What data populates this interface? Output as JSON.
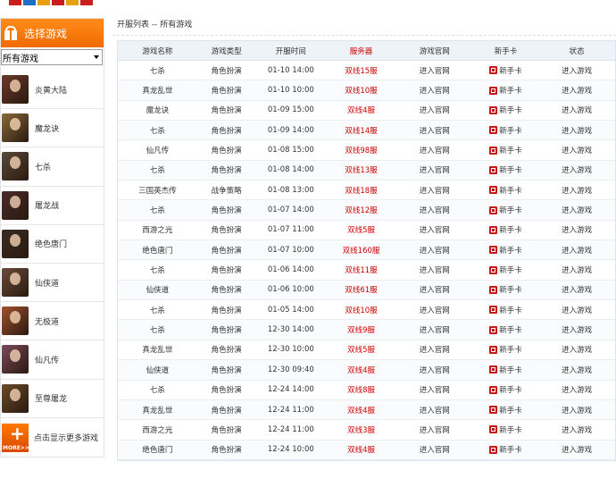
{
  "sidebar": {
    "title": "选择游戏",
    "select_value": "所有游戏",
    "games": [
      {
        "name": "炎黄大陆",
        "color": "#6b3a2a"
      },
      {
        "name": "魔龙诀",
        "color": "#8a6a3a"
      },
      {
        "name": "七杀",
        "color": "#5a4a3a"
      },
      {
        "name": "屠龙战",
        "color": "#4a2a2a"
      },
      {
        "name": "绝色唐门",
        "color": "#3a2a20"
      },
      {
        "name": "仙侠道",
        "color": "#6a4a3a"
      },
      {
        "name": "无极道",
        "color": "#a05030"
      },
      {
        "name": "仙凡传",
        "color": "#7a4a5a"
      },
      {
        "name": "至尊屠龙",
        "color": "#6a4a2a"
      }
    ],
    "more_label": "点击显示更多游戏",
    "more_icon_text": "MORE>>"
  },
  "main": {
    "breadcrumb": "开服列表 -- 所有游戏",
    "headers": [
      "游戏名称",
      "游戏类型",
      "开服时间",
      "服务器",
      "游戏官网",
      "新手卡",
      "状态"
    ],
    "rows": [
      {
        "name": "七杀",
        "type": "角色扮演",
        "time": "01-10 14:00",
        "server": "双线15服",
        "site": "进入官网",
        "card": "新手卡",
        "status": "进入游戏"
      },
      {
        "name": "真龙乱世",
        "type": "角色扮演",
        "time": "01-10 10:00",
        "server": "双线10服",
        "site": "进入官网",
        "card": "新手卡",
        "status": "进入游戏"
      },
      {
        "name": "魔龙诀",
        "type": "角色扮演",
        "time": "01-09 15:00",
        "server": "双线4服",
        "site": "进入官网",
        "card": "新手卡",
        "status": "进入游戏"
      },
      {
        "name": "七杀",
        "type": "角色扮演",
        "time": "01-09 14:00",
        "server": "双线14服",
        "site": "进入官网",
        "card": "新手卡",
        "status": "进入游戏"
      },
      {
        "name": "仙凡传",
        "type": "角色扮演",
        "time": "01-08 15:00",
        "server": "双线98服",
        "site": "进入官网",
        "card": "新手卡",
        "status": "进入游戏"
      },
      {
        "name": "七杀",
        "type": "角色扮演",
        "time": "01-08 14:00",
        "server": "双线13服",
        "site": "进入官网",
        "card": "新手卡",
        "status": "进入游戏"
      },
      {
        "name": "三国英杰传",
        "type": "战争策略",
        "time": "01-08 13:00",
        "server": "双线18服",
        "site": "进入官网",
        "card": "新手卡",
        "status": "进入游戏"
      },
      {
        "name": "七杀",
        "type": "角色扮演",
        "time": "01-07 14:00",
        "server": "双线12服",
        "site": "进入官网",
        "card": "新手卡",
        "status": "进入游戏"
      },
      {
        "name": "西游之光",
        "type": "角色扮演",
        "time": "01-07 11:00",
        "server": "双线5服",
        "site": "进入官网",
        "card": "新手卡",
        "status": "进入游戏"
      },
      {
        "name": "绝色唐门",
        "type": "角色扮演",
        "time": "01-07 10:00",
        "server": "双线160服",
        "site": "进入官网",
        "card": "新手卡",
        "status": "进入游戏"
      },
      {
        "name": "七杀",
        "type": "角色扮演",
        "time": "01-06 14:00",
        "server": "双线11服",
        "site": "进入官网",
        "card": "新手卡",
        "status": "进入游戏"
      },
      {
        "name": "仙侠道",
        "type": "角色扮演",
        "time": "01-06 10:00",
        "server": "双线61服",
        "site": "进入官网",
        "card": "新手卡",
        "status": "进入游戏"
      },
      {
        "name": "七杀",
        "type": "角色扮演",
        "time": "01-05 14:00",
        "server": "双线10服",
        "site": "进入官网",
        "card": "新手卡",
        "status": "进入游戏"
      },
      {
        "name": "七杀",
        "type": "角色扮演",
        "time": "12-30 14:00",
        "server": "双线9服",
        "site": "进入官网",
        "card": "新手卡",
        "status": "进入游戏"
      },
      {
        "name": "真龙乱世",
        "type": "角色扮演",
        "time": "12-30 10:00",
        "server": "双线5服",
        "site": "进入官网",
        "card": "新手卡",
        "status": "进入游戏"
      },
      {
        "name": "仙侠道",
        "type": "角色扮演",
        "time": "12-30 09:40",
        "server": "双线4服",
        "site": "进入官网",
        "card": "新手卡",
        "status": "进入游戏"
      },
      {
        "name": "七杀",
        "type": "角色扮演",
        "time": "12-24 14:00",
        "server": "双线8服",
        "site": "进入官网",
        "card": "新手卡",
        "status": "进入游戏"
      },
      {
        "name": "真龙乱世",
        "type": "角色扮演",
        "time": "12-24 11:00",
        "server": "双线4服",
        "site": "进入官网",
        "card": "新手卡",
        "status": "进入游戏"
      },
      {
        "name": "西游之光",
        "type": "角色扮演",
        "time": "12-24 11:00",
        "server": "双线3服",
        "site": "进入官网",
        "card": "新手卡",
        "status": "进入游戏"
      },
      {
        "name": "绝色唐门",
        "type": "角色扮演",
        "time": "12-24 10:00",
        "server": "双线4服",
        "site": "进入官网",
        "card": "新手卡",
        "status": "进入游戏"
      }
    ]
  },
  "colors": {
    "accent": "#f07a10",
    "server_red": "#cc0000"
  }
}
